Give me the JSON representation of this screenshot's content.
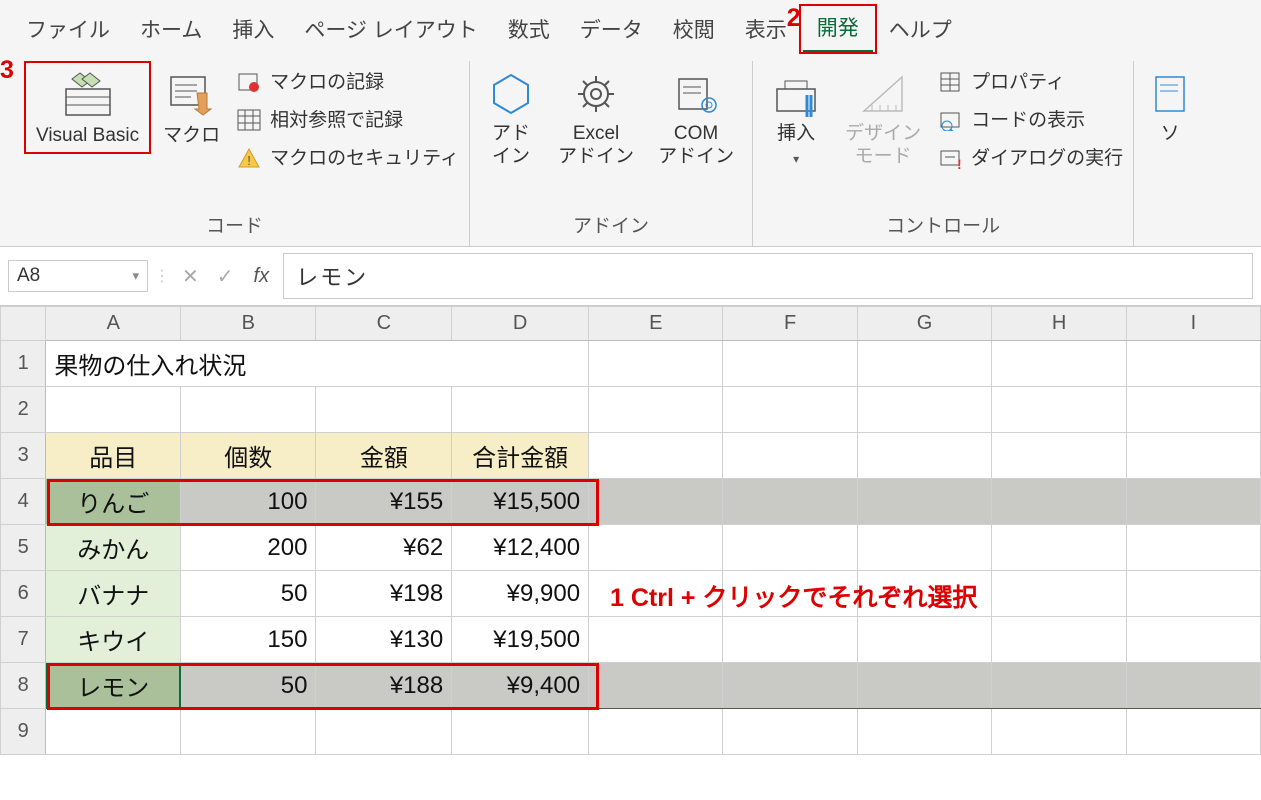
{
  "menubar": {
    "file": "ファイル",
    "home": "ホーム",
    "insert": "挿入",
    "page_layout": "ページ レイアウト",
    "formulas": "数式",
    "data": "データ",
    "review": "校閲",
    "view": "表示",
    "developer": "開発",
    "help": "ヘルプ"
  },
  "ribbon": {
    "code": {
      "vb": "Visual Basic",
      "macros": "マクロ",
      "record": "マクロの記録",
      "relative": "相対参照で記録",
      "security": "マクロのセキュリティ",
      "group_label": "コード"
    },
    "addins": {
      "addins": "アド\nイン",
      "excel_addins": "Excel\nアドイン",
      "com_addins": "COM\nアドイン",
      "group_label": "アドイン"
    },
    "controls": {
      "insert": "挿入",
      "design_mode": "デザイン\nモード",
      "properties": "プロパティ",
      "view_code": "コードの表示",
      "run_dialog": "ダイアログの実行",
      "group_label": "コントロール"
    },
    "source_partial": "ソ"
  },
  "formula_bar": {
    "name_box": "A8",
    "formula": "レモン"
  },
  "columns": [
    "A",
    "B",
    "C",
    "D",
    "E",
    "F",
    "G",
    "H",
    "I"
  ],
  "sheet": {
    "title": "果物の仕入れ状況",
    "headers": [
      "品目",
      "個数",
      "金額",
      "合計金額"
    ],
    "rows": [
      {
        "item": "りんご",
        "qty": "100",
        "price": "¥155",
        "total": "¥15,500"
      },
      {
        "item": "みかん",
        "qty": "200",
        "price": "¥62",
        "total": "¥12,400"
      },
      {
        "item": "バナナ",
        "qty": "50",
        "price": "¥198",
        "total": "¥9,900"
      },
      {
        "item": "キウイ",
        "qty": "150",
        "price": "¥130",
        "total": "¥19,500"
      },
      {
        "item": "レモン",
        "qty": "50",
        "price": "¥188",
        "total": "¥9,400"
      }
    ]
  },
  "annotations": {
    "n1": "1 Ctrl + クリックでそれぞれ選択",
    "n2": "2",
    "n3": "3"
  }
}
